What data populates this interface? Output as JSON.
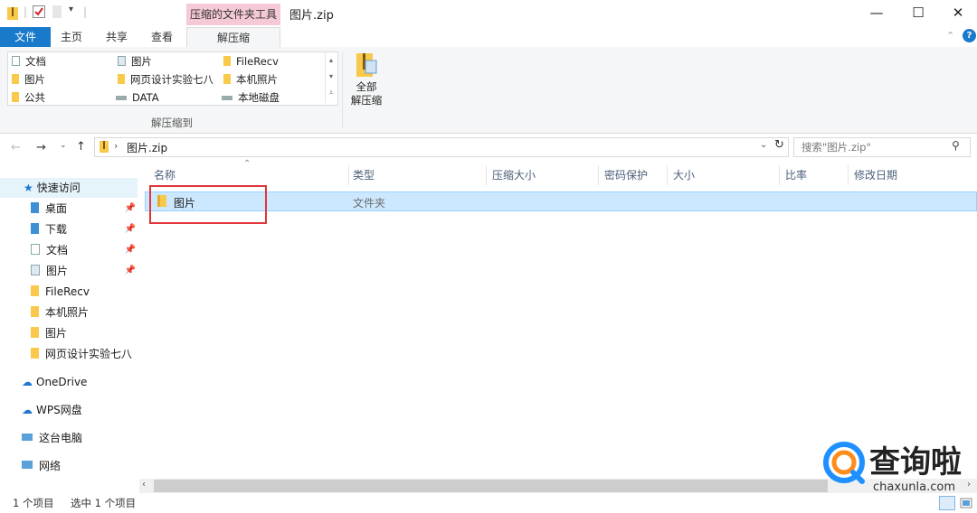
{
  "window": {
    "context_group": "压缩的文件夹工具",
    "title": "图片.zip",
    "minimize": "—",
    "maximize": "☐",
    "close": "✕"
  },
  "ribbon_tabs": {
    "file": "文件",
    "home": "主页",
    "share": "共享",
    "view": "查看",
    "extract": "解压缩",
    "help": "?"
  },
  "ribbon": {
    "gallery": [
      [
        "文档",
        "图片",
        "FileRecv"
      ],
      [
        "图片",
        "网页设计实验七八",
        "本机照片"
      ],
      [
        "公共",
        "DATA",
        "本地磁盘"
      ]
    ],
    "group_label": "解压缩到",
    "extract_all_line1": "全部",
    "extract_all_line2": "解压缩"
  },
  "address": {
    "path": "图片.zip",
    "search_placeholder": "搜索\"图片.zip\""
  },
  "nav": {
    "quick_access": "快速访问",
    "pinned": [
      "桌面",
      "下载",
      "文档",
      "图片"
    ],
    "recent": [
      "FileRecv",
      "本机照片",
      "图片",
      "网页设计实验七八"
    ],
    "onedrive": "OneDrive",
    "wps": "WPS网盘",
    "this_pc": "这台电脑",
    "network": "网络"
  },
  "columns": [
    "名称",
    "类型",
    "压缩大小",
    "密码保护",
    "大小",
    "比率",
    "修改日期"
  ],
  "rows": [
    {
      "name": "图片",
      "type": "文件夹"
    }
  ],
  "status": {
    "count": "1 个项目",
    "selected": "选中 1 个项目"
  },
  "watermark": {
    "brand": "查询啦",
    "domain": "chaxunla.com"
  },
  "colors": {
    "accent": "#1979ca",
    "context_tab": "#f5c9d6",
    "selection": "#cce8ff",
    "highlight_box": "#e0353b",
    "folder": "#f8c94a"
  }
}
